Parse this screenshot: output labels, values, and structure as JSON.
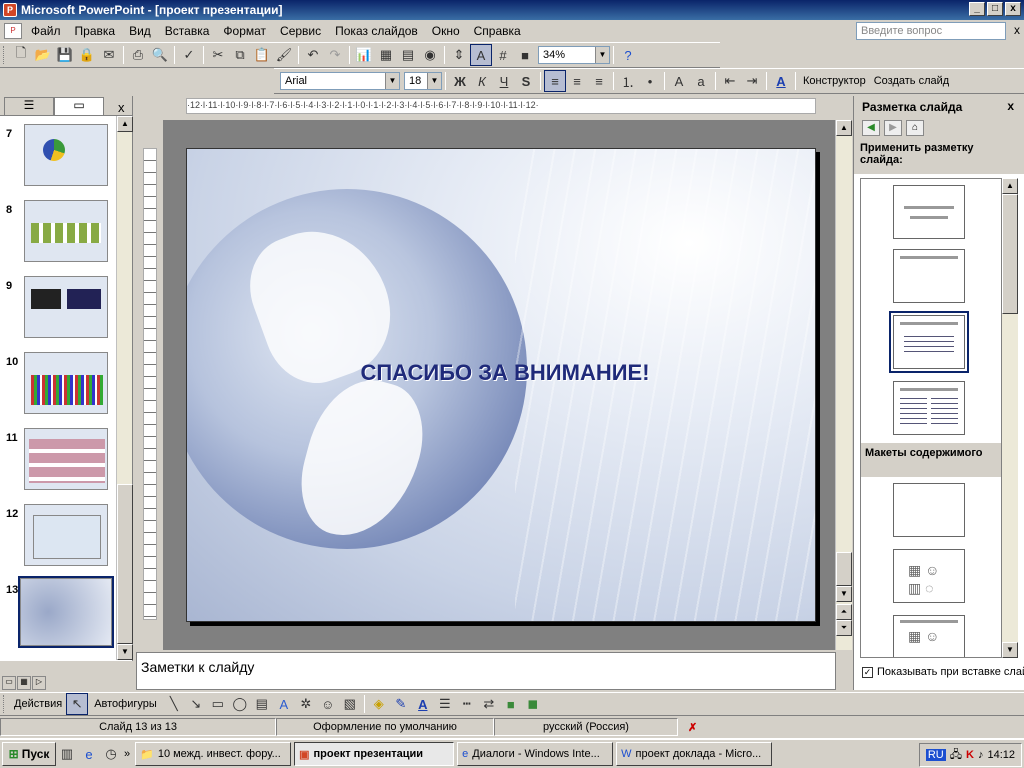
{
  "window": {
    "title": "Microsoft PowerPoint - [проект презентации]",
    "min": "_",
    "max": "□",
    "close": "x"
  },
  "menu": {
    "items": [
      "Файл",
      "Правка",
      "Вид",
      "Вставка",
      "Формат",
      "Сервис",
      "Показ слайдов",
      "Окно",
      "Справка"
    ],
    "ask_placeholder": "Введите вопрос",
    "close": "x"
  },
  "standard_toolbar": {
    "zoom": "34%"
  },
  "format_toolbar": {
    "font": "Arial",
    "size": "18",
    "bold": "Ж",
    "italic": "К",
    "underline": "Ч",
    "shadow": "S",
    "designer": "Конструктор",
    "new_slide": "Создать слайд"
  },
  "thumbnails": {
    "tab_outline": "☰",
    "tab_slides": "▭",
    "close": "x",
    "numbers": [
      "7",
      "8",
      "9",
      "10",
      "11",
      "12",
      "13"
    ]
  },
  "ruler": {
    "h_labels": "·12·l·11·l·10·l·9·l·8·l·7·l·6·l·5·l·4·l·3·l·2·l·1·l·0·l·1·l·2·l·3·l·4·l·5·l·6·l·7·l·8·l·9·l·10·l·11·l·12·"
  },
  "slide": {
    "title": "СПАСИБО ЗА ВНИМАНИЕ!"
  },
  "notes": {
    "placeholder": "Заметки к слайду"
  },
  "taskpane": {
    "title": "Разметка слайда",
    "apply_label": "Применить разметку слайда:",
    "section_content": "Макеты содержимого",
    "show_on_insert": "Показывать при вставке слайдов"
  },
  "drawing_toolbar": {
    "actions": "Действия",
    "autoshapes": "Автофигуры"
  },
  "status": {
    "slide_of": "Слайд 13 из 13",
    "design": "Оформление по умолчанию",
    "language": "русский (Россия)"
  },
  "taskbar": {
    "start": "Пуск",
    "tasks": [
      "10 межд. инвест. фору...",
      "проект презентации",
      "Диалоги - Windows Inte...",
      "проект доклада - Micro..."
    ],
    "lang": "RU",
    "time": "14:12"
  }
}
